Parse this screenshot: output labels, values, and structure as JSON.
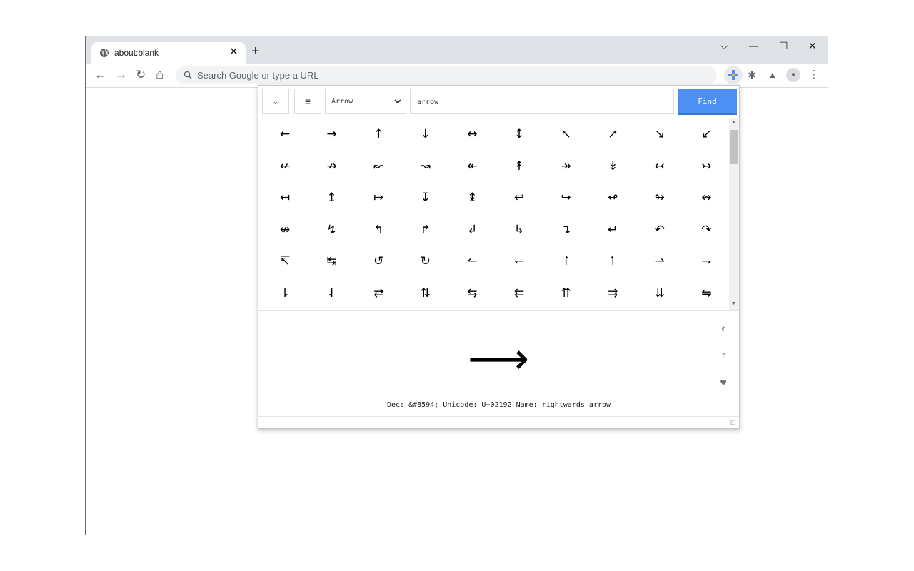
{
  "browser": {
    "tab_title": "about:blank",
    "tab_close": "✕",
    "new_tab": "+",
    "window_controls": {
      "tab_search": "⌵",
      "minimize": "—",
      "maximize": "☐",
      "close": "✕"
    },
    "nav": {
      "back": "←",
      "forward": "→",
      "reload": "↻",
      "home": "⌂"
    },
    "omnibox_placeholder": "Search Google or type a URL",
    "extensions": {
      "puzzle": "✱",
      "labs": "▲",
      "profile": "●",
      "menu": "⋮"
    }
  },
  "popup": {
    "collapse": "⌄",
    "menu": "≡",
    "category": "Arrow",
    "search_value": "arrow",
    "find_label": "Find",
    "symbols": [
      "←",
      "→",
      "↑",
      "↓",
      "↔",
      "↕",
      "↖",
      "↗",
      "↘",
      "↙",
      "↚",
      "↛",
      "↜",
      "↝",
      "↞",
      "↟",
      "↠",
      "↡",
      "↢",
      "↣",
      "↤",
      "↥",
      "↦",
      "↧",
      "↨",
      "↩",
      "↪",
      "↫",
      "↬",
      "↭",
      "↮",
      "↯",
      "↰",
      "↱",
      "↲",
      "↳",
      "↴",
      "↵",
      "↶",
      "↷",
      "↸",
      "↹",
      "↺",
      "↻",
      "↼",
      "↽",
      "↾",
      "↿",
      "⇀",
      "⇁",
      "⇂",
      "⇃",
      "⇄",
      "⇅",
      "⇆",
      "⇇",
      "⇈",
      "⇉",
      "⇊",
      "⇋"
    ],
    "preview_symbol": "⟶",
    "side_icons": {
      "copy": "¢",
      "help": "?",
      "favorite": "♥"
    },
    "info": "Dec: &#8594; Unicode: U+02192 Name: rightwards arrow",
    "resize": "◱"
  },
  "colors": {
    "accent": "#4c8ff5",
    "tabstrip": "#dee1e6",
    "omnibox": "#f1f3f4"
  }
}
